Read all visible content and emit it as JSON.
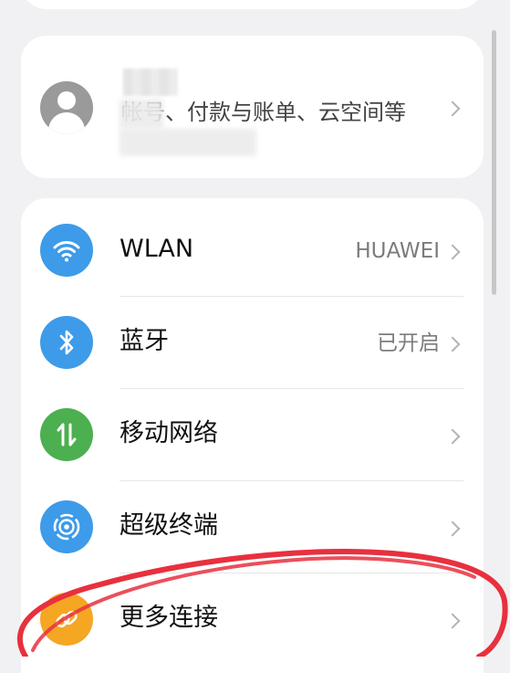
{
  "account": {
    "name": "",
    "description": "帐号、付款与账单、云空间等"
  },
  "settings": [
    {
      "id": "wlan",
      "label": "WLAN",
      "value": "HUAWEI",
      "icon": "wifi-icon",
      "color": "#3d9be9"
    },
    {
      "id": "bluetooth",
      "label": "蓝牙",
      "value": "已开启",
      "icon": "bluetooth-icon",
      "color": "#3d9be9"
    },
    {
      "id": "mobile-network",
      "label": "移动网络",
      "value": "",
      "icon": "mobile-data-icon",
      "color": "#4caf50"
    },
    {
      "id": "super-device",
      "label": "超级终端",
      "value": "",
      "icon": "super-device-icon",
      "color": "#3d9be9"
    },
    {
      "id": "more-connections",
      "label": "更多连接",
      "value": "",
      "icon": "link-icon",
      "color": "#f5a623"
    }
  ],
  "annotation_color": "#e8303e"
}
